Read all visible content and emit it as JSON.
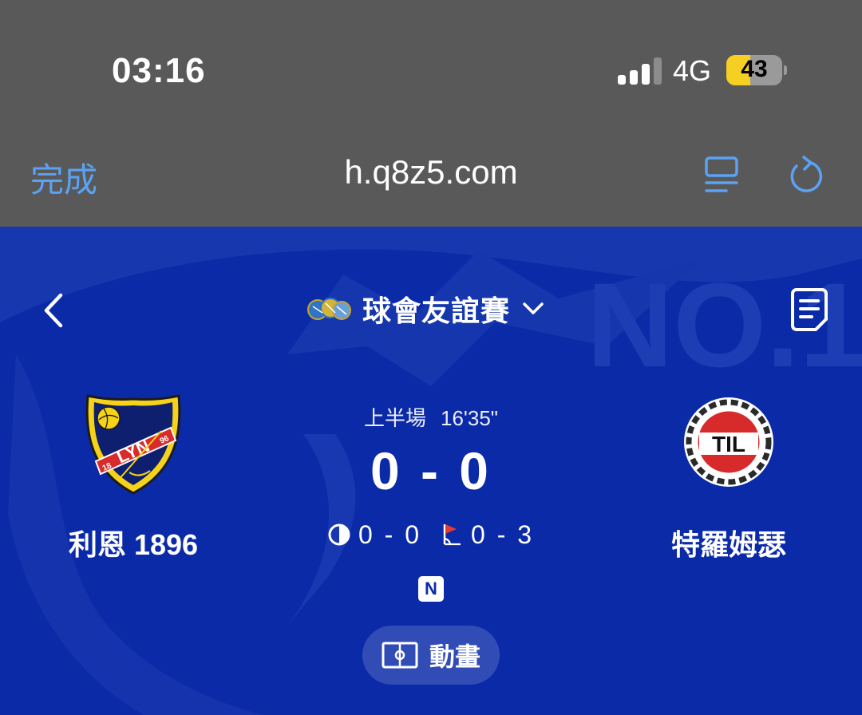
{
  "status_bar": {
    "time": "03:16",
    "network": "4G",
    "battery": "43",
    "battery_level": 0.43
  },
  "browser": {
    "done_label": "完成",
    "url": "h.q8z5.com"
  },
  "match": {
    "league": "球會友誼賽",
    "period": "上半場",
    "minute": "16'35\"",
    "score": "0 - 0",
    "half_time_score": "0 - 0",
    "corners": "0 - 3",
    "badge": "N",
    "animation_label": "動畫",
    "background_text": "NO.1",
    "home": {
      "name": "利恩 1896",
      "logo_text": "LYN",
      "logo_year_left": "18",
      "logo_year_right": "96"
    },
    "away": {
      "name": "特羅姆瑟",
      "logo_text": "TIL"
    }
  },
  "colors": {
    "chrome_bg": "#595959",
    "accent": "#5aa2f5",
    "match_bg": "#0b2aa8",
    "battery_fill": "#f5cf21"
  },
  "icons": {
    "back": "chevron-left-icon",
    "dropdown": "chevron-down-icon",
    "document": "document-icon",
    "reader": "reader-icon",
    "reload": "reload-icon",
    "half_time": "half-circle-icon",
    "corner": "corner-flag-icon",
    "pitch": "pitch-icon"
  }
}
